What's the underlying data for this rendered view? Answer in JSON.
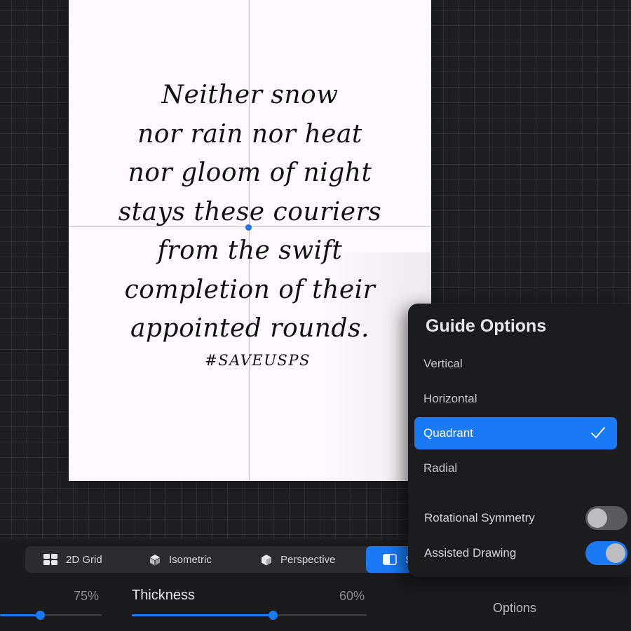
{
  "canvas": {
    "lines": [
      "Neither snow",
      "nor rain nor heat",
      "nor gloom of night",
      "stays these couriers",
      "from the swift",
      "completion of their",
      "appointed rounds."
    ],
    "hashtag": "#SAVEUSPS"
  },
  "guide_types": {
    "items": [
      {
        "label": "2D Grid",
        "icon": "grid-icon"
      },
      {
        "label": "Isometric",
        "icon": "isometric-cube-icon"
      },
      {
        "label": "Perspective",
        "icon": "perspective-cube-icon"
      },
      {
        "label": "S",
        "icon": "symmetry-icon",
        "active": true
      }
    ]
  },
  "sliders": {
    "opacity": {
      "value_text": "75%",
      "value": 0.39
    },
    "thickness": {
      "label": "Thickness",
      "value_text": "60%",
      "value": 0.6
    }
  },
  "options_label": "Options",
  "guide_options": {
    "title": "Guide Options",
    "options": [
      {
        "label": "Vertical",
        "selected": false
      },
      {
        "label": "Horizontal",
        "selected": false
      },
      {
        "label": "Quadrant",
        "selected": true
      },
      {
        "label": "Radial",
        "selected": false
      }
    ],
    "rotational_symmetry": {
      "label": "Rotational Symmetry",
      "on": false
    },
    "assisted_drawing": {
      "label": "Assisted Drawing",
      "on": true
    }
  },
  "colors": {
    "accent": "#1a7af5",
    "guide_line": "#eb8ca0",
    "canvas_bg": "#fdf8fb",
    "app_bg": "#1f1f21"
  }
}
